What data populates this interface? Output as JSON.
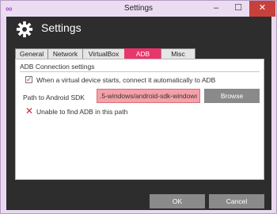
{
  "window": {
    "title": "Settings",
    "app_icon": "infinity-icon",
    "controls": {
      "minimize": "–",
      "maximize": "☐",
      "close": "✕"
    }
  },
  "header": {
    "title": "Settings",
    "icon": "gear-icon"
  },
  "tabs": [
    {
      "label": "General",
      "active": false
    },
    {
      "label": "Network",
      "active": false
    },
    {
      "label": "VirtualBox",
      "active": false
    },
    {
      "label": "ADB",
      "active": true
    },
    {
      "label": "Misc",
      "active": false
    }
  ],
  "adb": {
    "group_title": "ADB Connection settings",
    "auto_connect": {
      "label": "When a virtual device starts, connect it automatically to ADB",
      "checked": true
    },
    "path_label": "Path to Android SDK",
    "path_value": ".5-windows/android-sdk-windows/",
    "browse_label": "Browse",
    "error_text": "Unable to find ADB in this path"
  },
  "footer": {
    "ok_label": "OK",
    "cancel_label": "Cancel"
  },
  "colors": {
    "accent": "#ea356a",
    "error_field": "#f4a1a7",
    "button": "#8a8a8a",
    "dark_bg": "#2d2d2d",
    "close_button": "#c7403c"
  }
}
